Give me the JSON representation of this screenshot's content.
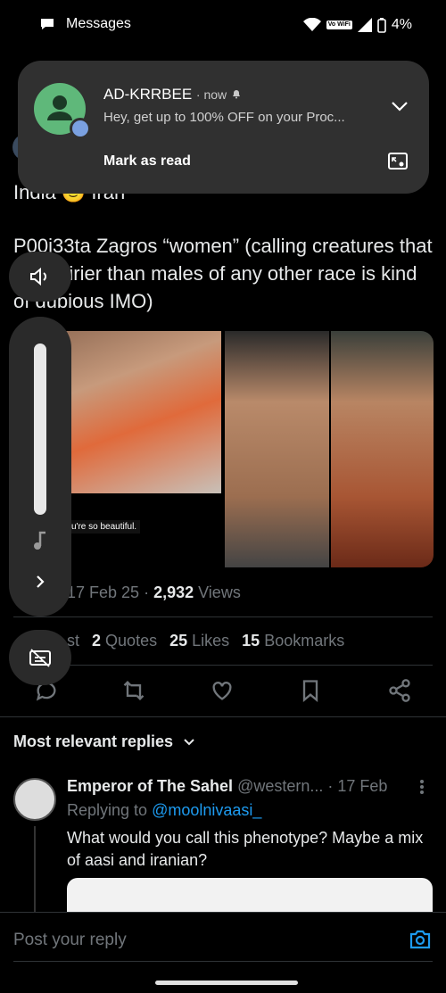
{
  "status_bar": {
    "app_label": "Messages",
    "wifi_badge": "Vo WiFi",
    "battery": "4%"
  },
  "tweet": {
    "line1": "India 🙂 Iran",
    "text": "P00i33ta Zagros “women” (calling creatures that are hairier than males of any other race is kind of dubious IMO)",
    "media_caption": "u're so beautiful.",
    "meta_date": "17 Feb 25",
    "views": "2,932",
    "views_label": "Views",
    "reposts_label": "st",
    "quotes_count": "2",
    "quotes_label": "Quotes",
    "likes_count": "25",
    "likes_label": "Likes",
    "bookmarks_count": "15",
    "bookmarks_label": "Bookmarks"
  },
  "replies_header": "Most relevant replies",
  "reply": {
    "name": "Emperor of The Sahel",
    "handle": "@western...",
    "date": "· 17 Feb",
    "replying_prefix": "Replying to",
    "replying_to": "@moolnivaasi_",
    "text": "What would you call this phenotype? Maybe a mix of aasi and iranian?"
  },
  "composer": {
    "placeholder": "Post your reply"
  },
  "notification": {
    "sender": "AD-KRRBEE",
    "time": "· now",
    "body": "Hey, get up to 100% OFF on your Proc...",
    "action": "Mark as read"
  },
  "colors": {
    "accent": "#1d9bf0",
    "muted": "#71767b",
    "notif_bg": "#303030",
    "avatar_green": "#5fb87a"
  }
}
